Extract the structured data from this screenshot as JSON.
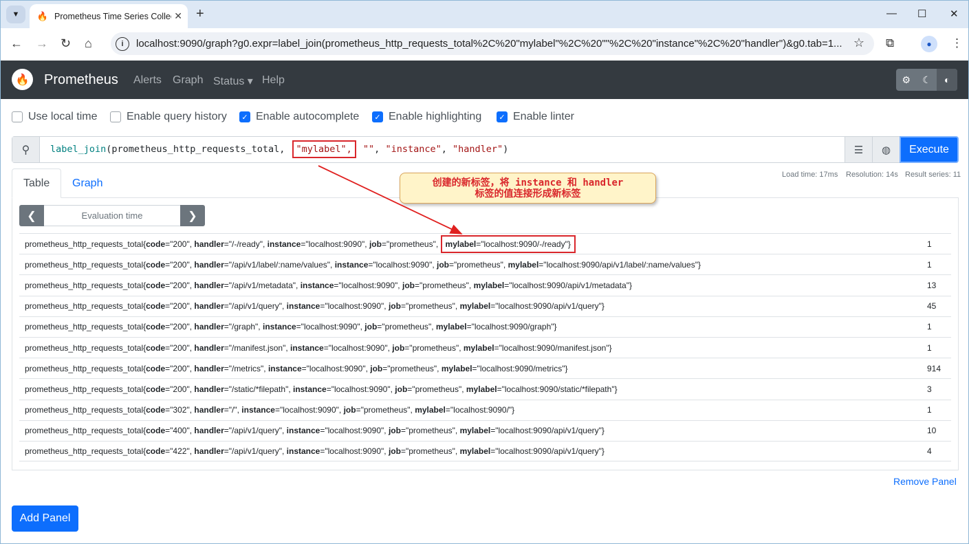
{
  "browser": {
    "tab_title": "Prometheus Time Series Collection and Processing Server",
    "url": "localhost:9090/graph?g0.expr=label_join(prometheus_http_requests_total%2C%20\"mylabel\"%2C%20\"\"%2C%20\"instance\"%2C%20\"handler\")&g0.tab=1..."
  },
  "navbar": {
    "brand": "Prometheus",
    "links": {
      "alerts": "Alerts",
      "graph": "Graph",
      "status": "Status ▾",
      "help": "Help"
    }
  },
  "options": {
    "use_local_time": {
      "label": "Use local time",
      "checked": false
    },
    "query_history": {
      "label": "Enable query history",
      "checked": false
    },
    "autocomplete": {
      "label": "Enable autocomplete",
      "checked": true
    },
    "highlighting": {
      "label": "Enable highlighting",
      "checked": true
    },
    "linter": {
      "label": "Enable linter",
      "checked": true
    }
  },
  "expression": {
    "fn": "label_join",
    "arg_metric": "(prometheus_http_requests_total, ",
    "arg_label": "\"mylabel\",",
    "arg_sep": " \"\"",
    "arg_rest_1": ", ",
    "arg_src1": "\"instance\"",
    "arg_rest_2": ", ",
    "arg_src2": "\"handler\"",
    "arg_close": ")"
  },
  "execute_label": "Execute",
  "stats": {
    "load_time": "Load time: 17ms",
    "resolution": "Resolution: 14s",
    "result_series": "Result series: 11"
  },
  "tabs": {
    "table": "Table",
    "graph": "Graph"
  },
  "eval_time_placeholder": "Evaluation time",
  "rows": [
    {
      "metric": "prometheus_http_requests_total{",
      "code": "200",
      "handler": "/-/ready",
      "mylabel": "localhost:9090/-/ready",
      "value": "1"
    },
    {
      "metric": "prometheus_http_requests_total{",
      "code": "200",
      "handler": "/api/v1/label/:name/values",
      "mylabel": "localhost:9090/api/v1/label/:name/values",
      "value": "1"
    },
    {
      "metric": "prometheus_http_requests_total{",
      "code": "200",
      "handler": "/api/v1/metadata",
      "mylabel": "localhost:9090/api/v1/metadata",
      "value": "13"
    },
    {
      "metric": "prometheus_http_requests_total{",
      "code": "200",
      "handler": "/api/v1/query",
      "mylabel": "localhost:9090/api/v1/query",
      "value": "45"
    },
    {
      "metric": "prometheus_http_requests_total{",
      "code": "200",
      "handler": "/graph",
      "mylabel": "localhost:9090/graph",
      "value": "1"
    },
    {
      "metric": "prometheus_http_requests_total{",
      "code": "200",
      "handler": "/manifest.json",
      "mylabel": "localhost:9090/manifest.json",
      "value": "1"
    },
    {
      "metric": "prometheus_http_requests_total{",
      "code": "200",
      "handler": "/metrics",
      "mylabel": "localhost:9090/metrics",
      "value": "914"
    },
    {
      "metric": "prometheus_http_requests_total{",
      "code": "200",
      "handler": "/static/*filepath",
      "mylabel": "localhost:9090/static/*filepath",
      "value": "3"
    },
    {
      "metric": "prometheus_http_requests_total{",
      "code": "302",
      "handler": "/",
      "mylabel": "localhost:9090/",
      "value": "1"
    },
    {
      "metric": "prometheus_http_requests_total{",
      "code": "400",
      "handler": "/api/v1/query",
      "mylabel": "localhost:9090/api/v1/query",
      "value": "10"
    },
    {
      "metric": "prometheus_http_requests_total{",
      "code": "422",
      "handler": "/api/v1/query",
      "mylabel": "localhost:9090/api/v1/query",
      "value": "4"
    }
  ],
  "label_keys": {
    "code": "code",
    "handler": "handler",
    "instance": "instance",
    "job": "job",
    "mylabel": "mylabel"
  },
  "instance_value": "localhost:9090",
  "job_value": "prometheus",
  "remove_panel": "Remove Panel",
  "add_panel": "Add Panel",
  "annotation": {
    "line1": "创建的新标签，将 instance 和 handler",
    "line2": "标签的值连接形成新标签"
  },
  "colors": {
    "primary": "#0d6efd",
    "navbar": "#343a40",
    "annotation_red": "#d9262b"
  }
}
